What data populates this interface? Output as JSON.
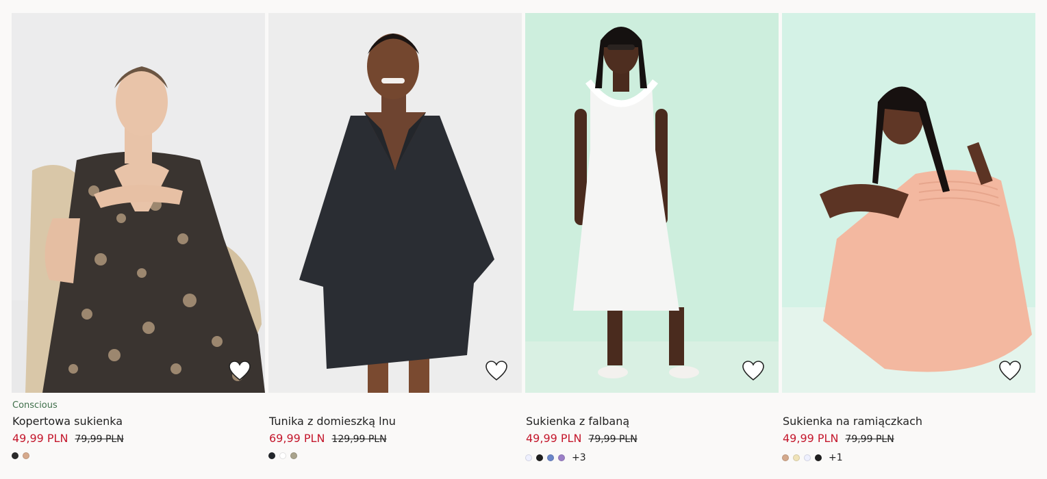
{
  "colors": {
    "sale": "#c4172c",
    "conscious": "#3f6f4a"
  },
  "products": [
    {
      "tag": "Conscious",
      "title": "Kopertowa sukienka",
      "price": "49,99 PLN",
      "old_price": "79,99 PLN",
      "swatches": [
        "#2b2b2b",
        "#d6a98c"
      ],
      "more": ""
    },
    {
      "tag": "",
      "title": "Tunika z domieszką lnu",
      "price": "69,99 PLN",
      "old_price": "129,99 PLN",
      "swatches": [
        "#23262b",
        "#ffffff",
        "#a9a38c"
      ],
      "more": ""
    },
    {
      "tag": "",
      "title": "Sukienka z falbaną",
      "price": "49,99 PLN",
      "old_price": "79,99 PLN",
      "swatches": [
        "#eef0ff",
        "#1f1f1f",
        "#6b86c9",
        "#9b7fc7"
      ],
      "more": "+3"
    },
    {
      "tag": "",
      "title": "Sukienka na ramiączkach",
      "price": "49,99 PLN",
      "old_price": "79,99 PLN",
      "swatches": [
        "#d4a98c",
        "#f0e3b8",
        "#eef0ff",
        "#1f1f1f"
      ],
      "more": "+1"
    }
  ]
}
